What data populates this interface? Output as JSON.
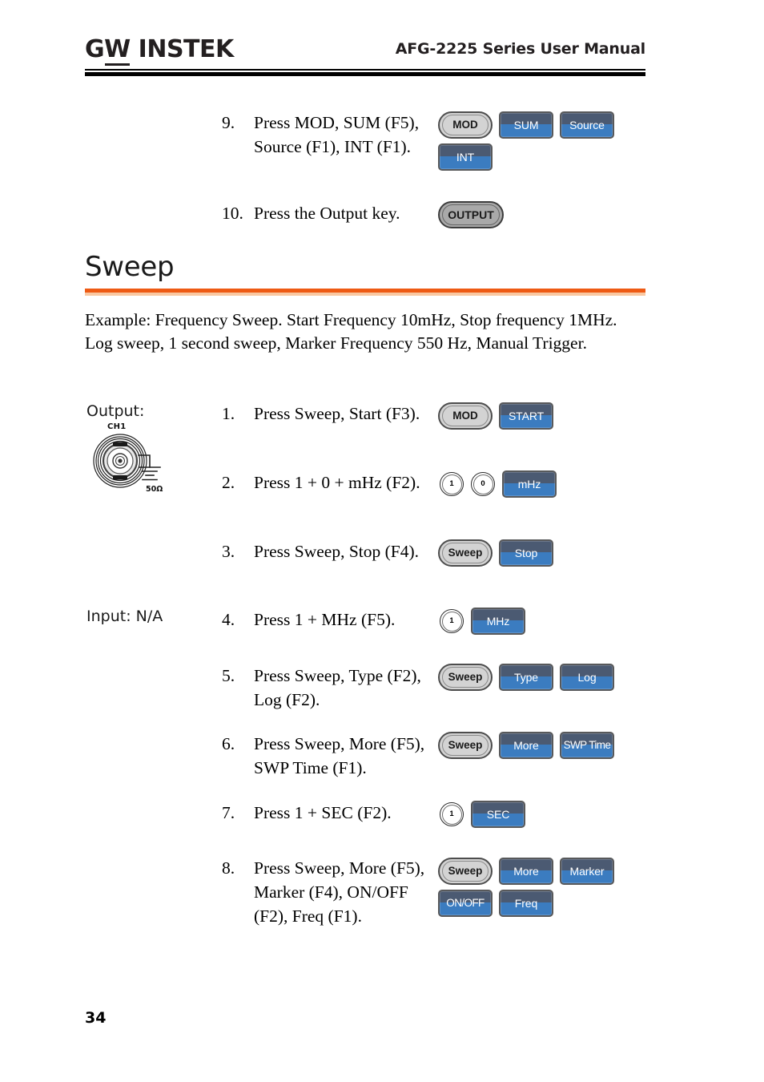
{
  "header": {
    "logo_g": "G",
    "logo_w": "W",
    "logo_rest": "INSTEK",
    "title": "AFG-2225 Series User Manual"
  },
  "colors": {
    "accent_orange": "#ee5a14",
    "accent_orange_light": "#f9c8a2",
    "button_blue_top": "#4b5a72",
    "button_blue_bottom": "#3b7cc0",
    "button_gray": "#d3d3d3",
    "button_output_gray": "#a9a9a9"
  },
  "top_steps": [
    {
      "number": "9.",
      "text": "Press MOD, SUM (F5), Source (F1), INT (F1).",
      "keys_row1": [
        {
          "label": "MOD",
          "style": "gray"
        },
        {
          "label": "SUM",
          "style": "blue"
        },
        {
          "label": "Source",
          "style": "blue"
        }
      ],
      "keys_row2": [
        {
          "label": "INT",
          "style": "blue"
        }
      ]
    },
    {
      "number": "10.",
      "text": "Press the Output key.",
      "keys_row1": [
        {
          "label": "OUTPUT",
          "style": "gray-output"
        }
      ],
      "keys_row2": []
    }
  ],
  "section": {
    "heading": "Sweep",
    "example": "Example: Frequency Sweep. Start Frequency 10mHz, Stop frequency 1MHz. Log sweep, 1 second sweep, Marker Frequency 550 Hz, Manual Trigger."
  },
  "left_column": {
    "output_label": "Output:",
    "input_label": "Input: N/A",
    "connector_channel": "CH1",
    "connector_impedance": "50Ω"
  },
  "sweep_steps": [
    {
      "number": "1.",
      "text": "Press Sweep, Start (F3).",
      "keys_row1": [
        {
          "label": "MOD",
          "style": "gray"
        },
        {
          "label": "START",
          "style": "blue"
        }
      ],
      "keys_row2": []
    },
    {
      "number": "2.",
      "text": "Press 1 + 0 + mHz (F2).",
      "keys_row1": [
        {
          "label": "1",
          "style": "round"
        },
        {
          "label": "0",
          "style": "round"
        },
        {
          "label": "mHz",
          "style": "blue"
        }
      ],
      "keys_row2": []
    },
    {
      "number": "3.",
      "text": "Press Sweep, Stop (F4).",
      "keys_row1": [
        {
          "label": "Sweep",
          "style": "gray"
        },
        {
          "label": "Stop",
          "style": "blue"
        }
      ],
      "keys_row2": []
    },
    {
      "number": "4.",
      "text": "Press 1 + MHz (F5).",
      "keys_row1": [
        {
          "label": "1",
          "style": "round"
        },
        {
          "label": "MHz",
          "style": "blue"
        }
      ],
      "keys_row2": []
    },
    {
      "number": "5.",
      "text": "Press Sweep, Type (F2), Log (F2).",
      "keys_row1": [
        {
          "label": "Sweep",
          "style": "gray"
        },
        {
          "label": "Type",
          "style": "blue"
        },
        {
          "label": "Log",
          "style": "blue"
        }
      ],
      "keys_row2": []
    },
    {
      "number": "6.",
      "text": "Press Sweep, More (F5), SWP Time (F1).",
      "keys_row1": [
        {
          "label": "Sweep",
          "style": "gray"
        },
        {
          "label": "More",
          "style": "blue"
        },
        {
          "label": "SWP Time",
          "style": "blue-tight"
        }
      ],
      "keys_row2": []
    },
    {
      "number": "7.",
      "text": "Press 1 + SEC (F2).",
      "keys_row1": [
        {
          "label": "1",
          "style": "round"
        },
        {
          "label": "SEC",
          "style": "blue"
        }
      ],
      "keys_row2": []
    },
    {
      "number": "8.",
      "text": "Press Sweep, More (F5), Marker (F4), ON/OFF (F2), Freq (F1).",
      "keys_row1": [
        {
          "label": "Sweep",
          "style": "gray"
        },
        {
          "label": "More",
          "style": "blue"
        },
        {
          "label": "Marker",
          "style": "blue"
        }
      ],
      "keys_row2": [
        {
          "label": "ON/OFF",
          "style": "blue-tight"
        },
        {
          "label": "Freq",
          "style": "blue"
        }
      ]
    }
  ],
  "footer": {
    "page_number": "34"
  }
}
